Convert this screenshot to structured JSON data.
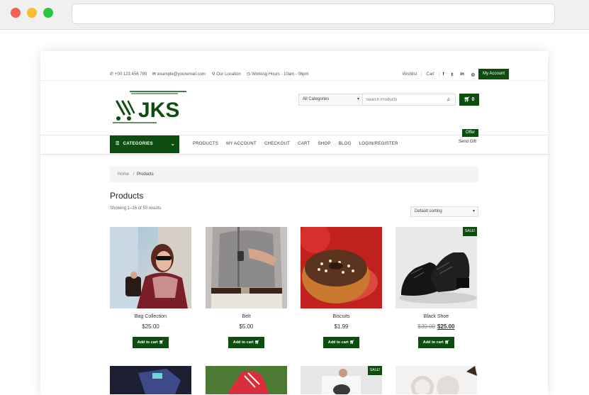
{
  "topbar": {
    "phone": "+00 123 456 789",
    "email": "example@youremail.com",
    "location": "Our Location",
    "hours": "Working Hours - 10am - 06pm",
    "links": [
      "Wishlist",
      "Cart"
    ],
    "social_icons": [
      "facebook-icon",
      "twitter-icon",
      "linkedin-icon",
      "instagram-icon"
    ],
    "account_label": "My Account"
  },
  "header": {
    "logo_text": "JKS",
    "category_select": "All Categories",
    "search_placeholder": "Search Products",
    "cart_count": "0"
  },
  "nav": {
    "categories_label": "CATEGORIES",
    "menu": [
      "PRODUCTS",
      "MY ACCOUNT",
      "CHECKOUT",
      "CART",
      "SHOP",
      "BLOG",
      "LOGIN/REGISTER"
    ],
    "offer_badge": "Offer",
    "send_gift": "Send Gift"
  },
  "breadcrumb": {
    "home": "Home",
    "separator": "/",
    "current": "Products"
  },
  "page": {
    "title": "Products",
    "showing": "Showing 1–16 of 50 results",
    "sort": "Default sorting"
  },
  "products": [
    {
      "name": "Bag Collection",
      "price": "$25.00",
      "add": "Add to cart"
    },
    {
      "name": "Belt",
      "price": "$5.00",
      "add": "Add to cart"
    },
    {
      "name": "Biscuits",
      "price": "$1.99",
      "add": "Add to cart"
    },
    {
      "name": "Black Shoe",
      "old_price": "$30.00",
      "price": "$25.00",
      "sale": "SALE!",
      "add": "Add to cart"
    }
  ],
  "second_row_sale": "SALE!",
  "colors": {
    "brand_green": "#0d4d10"
  }
}
